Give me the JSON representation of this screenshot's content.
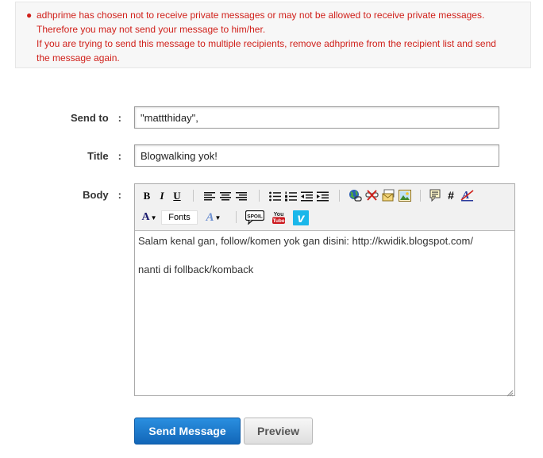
{
  "error": {
    "line1": "adhprime has chosen not to receive private messages or may not be allowed to receive private messages.",
    "line2": "Therefore you may not send your message to him/her.",
    "line3": "If you are trying to send this message to multiple recipients, remove adhprime from the recipient list and send",
    "line4": "the message again."
  },
  "form": {
    "send_to_label": "Send to",
    "title_label": "Title",
    "body_label": "Body",
    "colon": ":",
    "send_to_value": "\"mattthiday\",",
    "title_value": "Blogwalking yok!",
    "body_text": "Salam kenal gan, follow/komen yok gan disini: http://kwidik.blogspot.com/\n\nnanti di follback/komback"
  },
  "toolbar": {
    "bold": "B",
    "italic": "I",
    "underline": "U",
    "fonts": "Fonts",
    "hash": "#",
    "font_color": "A",
    "font_size": "A",
    "strike_a": "A",
    "spoiler": "SPOIL",
    "youtube_top": "You",
    "youtube_bottom": "Tube",
    "vimeo": "v"
  },
  "icons": [
    "bold-icon",
    "italic-icon",
    "underline-icon",
    "align-left-icon",
    "align-center-icon",
    "align-right-icon",
    "bulleted-list-icon",
    "numbered-list-icon",
    "outdent-icon",
    "indent-icon",
    "insert-link-icon",
    "remove-link-icon",
    "email-icon",
    "image-icon",
    "quote-icon",
    "hash-icon",
    "remove-format-icon",
    "font-color-icon",
    "font-size-icon",
    "spoiler-icon",
    "youtube-icon",
    "vimeo-icon"
  ],
  "buttons": {
    "send": "Send Message",
    "preview": "Preview"
  },
  "colors": {
    "error_text": "#d0211b",
    "primary_button": "#1a74c6",
    "vimeo": "#1ab7ea",
    "youtube": "#cc181e"
  }
}
